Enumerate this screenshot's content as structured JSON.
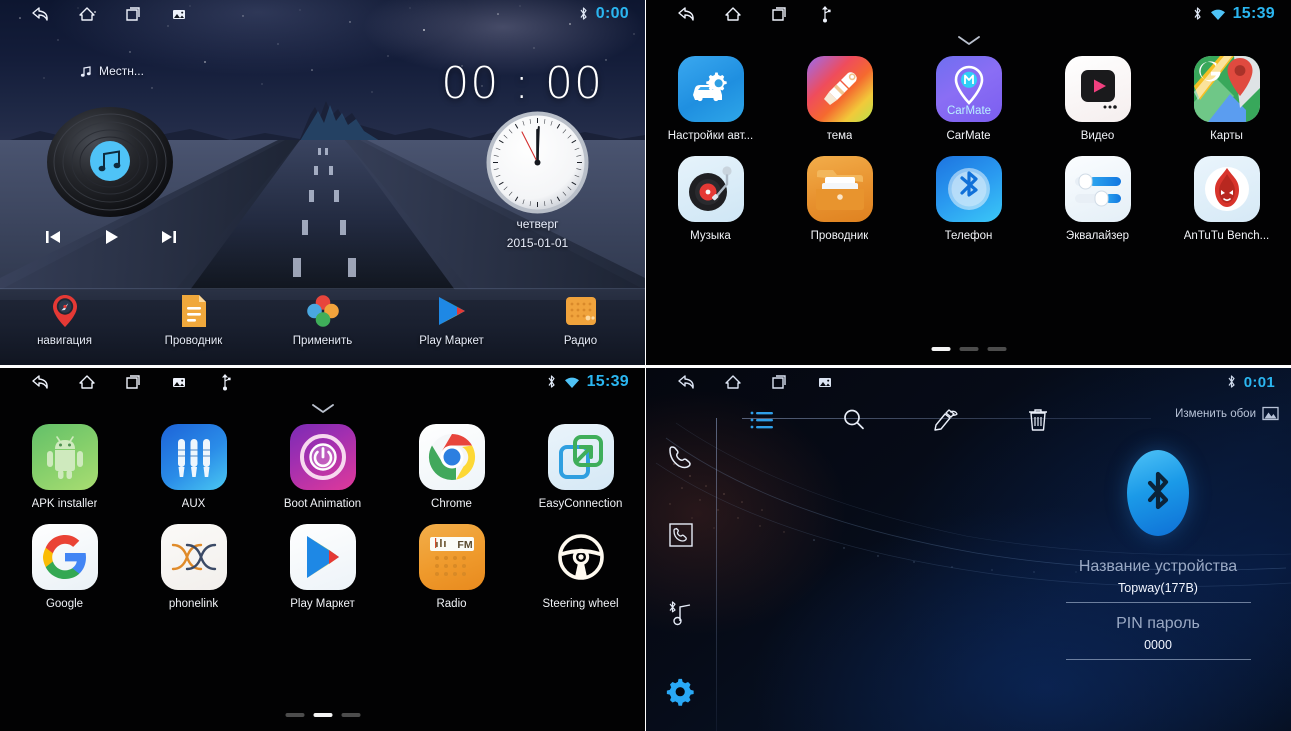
{
  "panels": {
    "home": {
      "name": "Home screen",
      "statusbar": {
        "nav": [
          "back-icon",
          "home-icon",
          "recents-icon",
          "screenshot-icon"
        ],
        "indicators": [
          "bluetooth-icon"
        ],
        "time": "0:00"
      },
      "media_widget": {
        "source_label": "Местн...",
        "note_icon": "music-note-icon",
        "prev_label": "prev-track",
        "play_label": "play",
        "next_label": "next-track"
      },
      "clock_widget": {
        "digital_time": "00 : 00",
        "weekday": "четверг",
        "date": "2015-01-01"
      },
      "dock": [
        {
          "label": "навигация",
          "icon": "navigation-pin-icon"
        },
        {
          "label": "Проводник",
          "icon": "file-manager-icon"
        },
        {
          "label": "Применить",
          "icon": "apps-clover-icon"
        },
        {
          "label": "Play Маркет",
          "icon": "play-store-icon"
        },
        {
          "label": "Радио",
          "icon": "radio-icon"
        }
      ]
    },
    "drawer1": {
      "name": "App drawer page 1",
      "statusbar": {
        "nav": [
          "back-icon",
          "home-icon",
          "recents-icon",
          "usb-icon"
        ],
        "indicators": [
          "bluetooth-icon",
          "wifi-icon"
        ],
        "time": "15:39"
      },
      "chevron": "chevron-down-icon",
      "apps": [
        {
          "label": "Настройки авт...",
          "icon": "car-settings-icon"
        },
        {
          "label": "тема",
          "icon": "theme-brush-icon"
        },
        {
          "label": "CarMate",
          "icon": "carmate-icon"
        },
        {
          "label": "Видео",
          "icon": "video-player-icon"
        },
        {
          "label": "Карты",
          "icon": "google-maps-icon"
        },
        {
          "label": "Музыка",
          "icon": "music-turntable-icon"
        },
        {
          "label": "Проводник",
          "icon": "file-explorer-icon"
        },
        {
          "label": "Телефон",
          "icon": "bluetooth-phone-icon"
        },
        {
          "label": "Эквалайзер",
          "icon": "equalizer-icon"
        },
        {
          "label": "AnTuTu Bench...",
          "icon": "antutu-icon"
        }
      ],
      "pager": {
        "count": 3,
        "active": 0
      }
    },
    "drawer2": {
      "name": "App drawer page 2",
      "statusbar": {
        "nav": [
          "back-icon",
          "home-icon",
          "recents-icon",
          "screenshot-icon",
          "usb-icon"
        ],
        "indicators": [
          "bluetooth-icon",
          "wifi-icon"
        ],
        "time": "15:39"
      },
      "chevron": "chevron-down-icon",
      "apps": [
        {
          "label": "APK installer",
          "icon": "android-robot-icon"
        },
        {
          "label": "AUX",
          "icon": "aux-jack-icon"
        },
        {
          "label": "Boot Animation",
          "icon": "power-ring-icon"
        },
        {
          "label": "Chrome",
          "icon": "chrome-icon"
        },
        {
          "label": "EasyConnection",
          "icon": "easyconnection-icon"
        },
        {
          "label": "Google",
          "icon": "google-g-icon"
        },
        {
          "label": "phonelink",
          "icon": "phonelink-icon"
        },
        {
          "label": "Play Маркет",
          "icon": "play-store-icon"
        },
        {
          "label": "Radio",
          "icon": "fm-radio-icon"
        },
        {
          "label": "Steering wheel",
          "icon": "steering-wheel-icon"
        }
      ],
      "pager": {
        "count": 3,
        "active": 1
      }
    },
    "bluetooth": {
      "name": "Bluetooth settings",
      "statusbar": {
        "nav": [
          "back-icon",
          "home-icon",
          "recents-icon",
          "screenshot-icon"
        ],
        "indicators": [
          "bluetooth-icon"
        ],
        "time": "0:01"
      },
      "sidebar": [
        {
          "icon": "phone-dial-icon",
          "active": false
        },
        {
          "icon": "call-log-icon",
          "active": false
        },
        {
          "icon": "bluetooth-music-icon",
          "active": false
        },
        {
          "icon": "settings-gear-icon",
          "active": true
        }
      ],
      "toolbar": [
        {
          "icon": "list-icon",
          "active": true
        },
        {
          "icon": "search-icon",
          "active": false
        },
        {
          "icon": "edit-hand-icon",
          "active": false
        },
        {
          "icon": "trash-icon",
          "active": false
        }
      ],
      "wallpaper_button": {
        "label": "Изменить обои",
        "icon": "image-icon"
      },
      "device": {
        "logo_icon": "bluetooth-logo-icon",
        "name_label": "Название устройства",
        "name_value": "Topway(177B)",
        "pin_label": "PIN пароль",
        "pin_value": "0000"
      }
    }
  },
  "colors": {
    "accent_blue": "#2bb6f0",
    "drawer_bg": "#020203",
    "label_white": "#f2f4f8",
    "bt_label_gray": "#9aa9c4"
  }
}
